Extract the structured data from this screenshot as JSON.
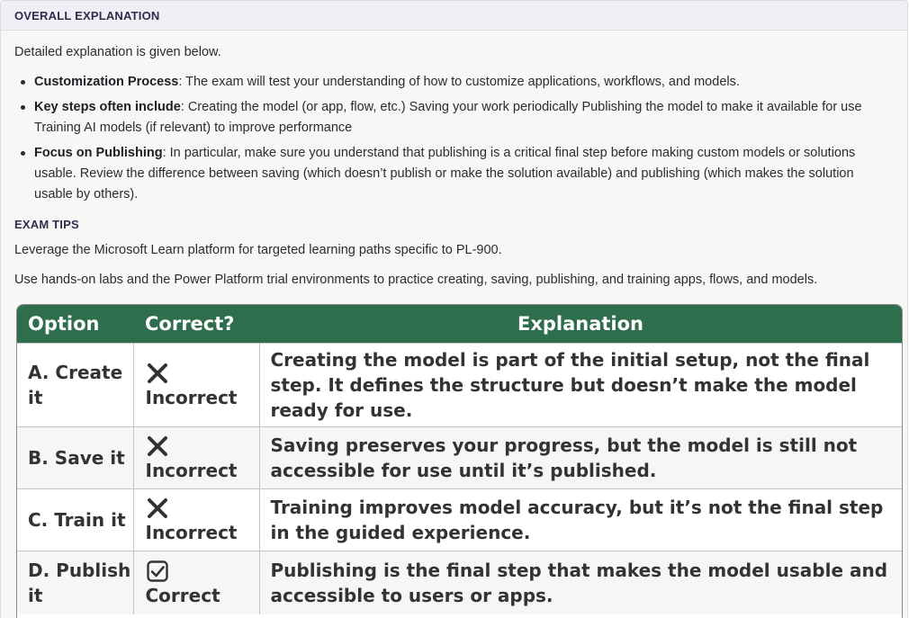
{
  "section": {
    "title": "OVERALL EXPLANATION",
    "intro": "Detailed explanation is given below.",
    "bullets": [
      {
        "term": "Customization Process",
        "text": ": The exam will test your understanding of how to customize applications, workflows, and models."
      },
      {
        "term": "Key steps often include",
        "text": ": Creating the model (or app, flow, etc.) Saving your work periodically Publishing the model to make it available for use Training AI models (if relevant) to improve performance"
      },
      {
        "term": "Focus on Publishing",
        "text": ": In particular, make sure you understand that publishing is a critical final step before making custom models or solutions usable. Review the difference between saving (which doesn’t publish or make the solution available) and publishing (which makes the solution usable by others)."
      }
    ],
    "tips_title": "EXAM TIPS",
    "tips": [
      "Leverage the Microsoft Learn platform for targeted learning paths specific to PL-900.",
      "Use hands-on labs and the Power Platform trial environments to practice creating, saving, publishing, and training apps, flows, and models."
    ]
  },
  "table": {
    "headers": {
      "option": "Option",
      "correct": "Correct?",
      "explanation": "Explanation"
    },
    "rows": [
      {
        "option": "A. Create it",
        "icon": "cross-icon",
        "status": "Incorrect",
        "explanation": "Creating the model is part of the initial setup, not the final step. It defines the structure but doesn’t make the model ready for use."
      },
      {
        "option": "B. Save it",
        "icon": "cross-icon",
        "status": "Incorrect",
        "explanation": "Saving preserves your progress, but the model is still not accessible for use until it’s published."
      },
      {
        "option": "C. Train it",
        "icon": "cross-icon",
        "status": "Incorrect",
        "explanation": "Training improves model accuracy, but it’s not the final step in the guided experience."
      },
      {
        "option": "D. Publish it",
        "icon": "checkbox-check-icon",
        "status": "Correct",
        "explanation": "Publishing is the final step that makes the model usable and accessible to users or apps."
      }
    ],
    "colors": {
      "header_bg": "#2f6e4c",
      "header_text": "#ffffff"
    }
  }
}
